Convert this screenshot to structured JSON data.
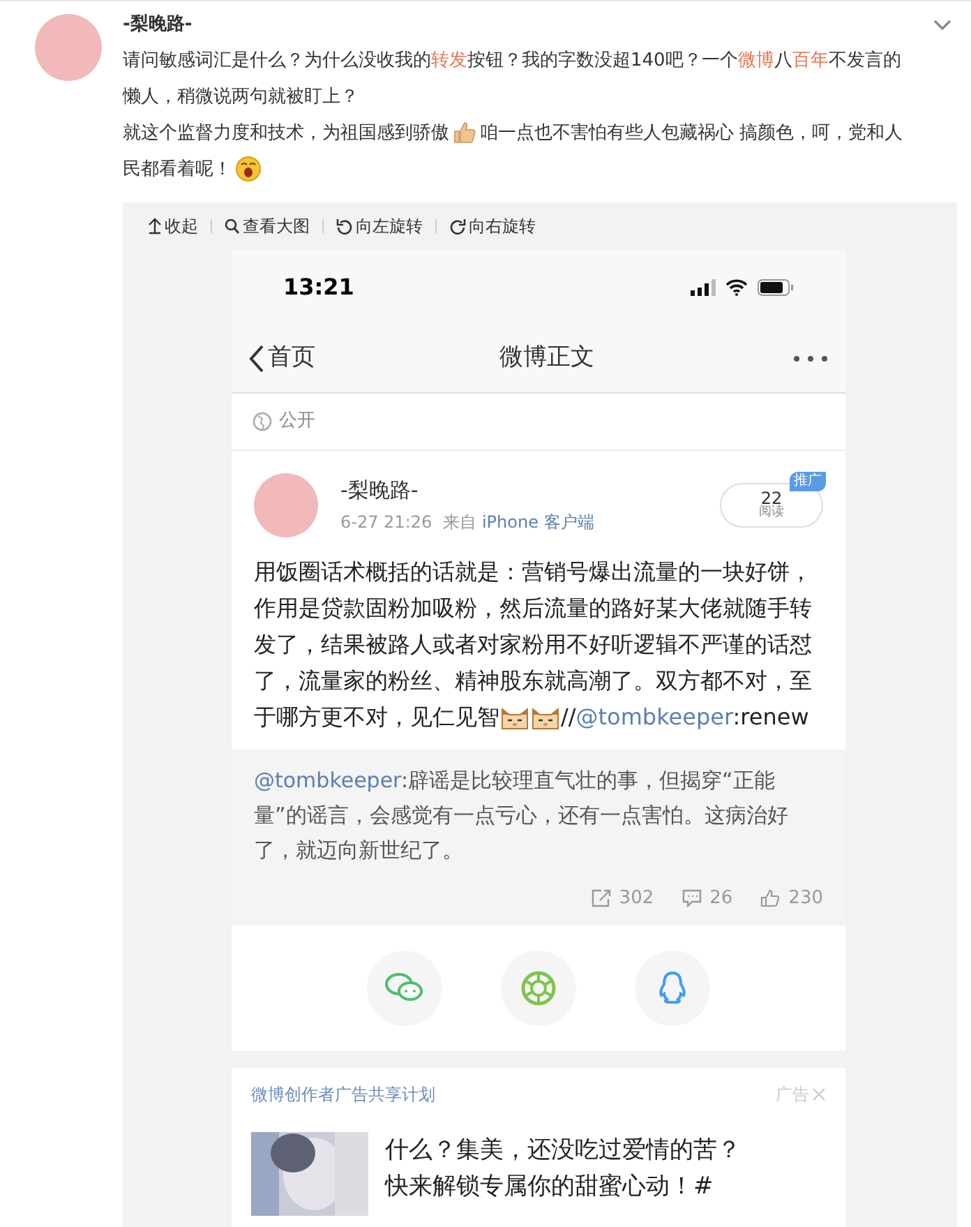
{
  "post": {
    "author": "-梨晚路-",
    "paragraphs": [
      [
        {
          "kind": "text",
          "text": "请问敏感词汇是什么？为什么没收我的"
        },
        {
          "kind": "highlight",
          "text": "转发"
        },
        {
          "kind": "text",
          "text": "按钮？我的字数没超140吧？一个"
        },
        {
          "kind": "highlight",
          "text": "微博"
        },
        {
          "kind": "text",
          "text": "八"
        },
        {
          "kind": "highlight",
          "text": "百年"
        },
        {
          "kind": "text",
          "text": "不发言的懒人，稍微说两句就被盯上？"
        }
      ],
      [
        {
          "kind": "text",
          "text": "就这个监督力度和技术，为祖国感到骄傲"
        },
        {
          "kind": "thumb"
        },
        {
          "kind": "text",
          "text": "咱一点也不害怕有些人包藏祸心 搞颜色，呵，党和人民都看着呢！"
        },
        {
          "kind": "face"
        }
      ]
    ]
  },
  "toolbar": [
    "收起",
    "查看大图",
    "向左旋转",
    "向右旋转"
  ],
  "phone": {
    "time": "13:21",
    "back": "首页",
    "title": "微博正文",
    "visibility": "公开",
    "author": "-梨晚路-",
    "date": "6-27 21:26",
    "source_prefix": "来自",
    "source": "iPhone 客户端",
    "reads": "22",
    "reads_label": "阅读",
    "promo_badge": "推广",
    "body": [
      {
        "kind": "text",
        "text": "用饭圈话术概括的话就是：营销号爆出流量的一块好饼，作用是贷款固粉加吸粉，然后流量的路好某大佬就随手转发了，结果被路人或者对家粉用不好听逻辑不严谨的话怼了，流量家的粉丝、精神股东就高潮了。双方都不对，至于哪方更不对，见仁见智"
      },
      {
        "kind": "cat"
      },
      {
        "kind": "cat"
      },
      {
        "kind": "text",
        "text": "//"
      },
      {
        "kind": "mention",
        "text": "@tombkeeper"
      },
      {
        "kind": "text",
        "text": ":renew"
      }
    ],
    "repost": [
      {
        "kind": "mention",
        "text": "@tombkeeper"
      },
      {
        "kind": "text",
        "text": ":辟谣是比较理直气壮的事，但揭穿“正能量”的谣言，会感觉有一点亏心，还有一点害怕。这病治好了，就迈向新世纪了。"
      }
    ],
    "stats": [
      {
        "kind": "repost",
        "text": "302"
      },
      {
        "kind": "comment",
        "text": "26"
      },
      {
        "kind": "like",
        "text": "230"
      }
    ],
    "share": [
      {
        "kind": "wechat"
      },
      {
        "kind": "moments"
      },
      {
        "kind": "qq"
      }
    ],
    "ad_title": "微博创作者广告共享计划",
    "ad_label": "广告",
    "ad_lines": [
      "什么？集美，还没吃过爱情的苦？",
      "快来解锁专属你的甜蜜心动！#"
    ]
  }
}
